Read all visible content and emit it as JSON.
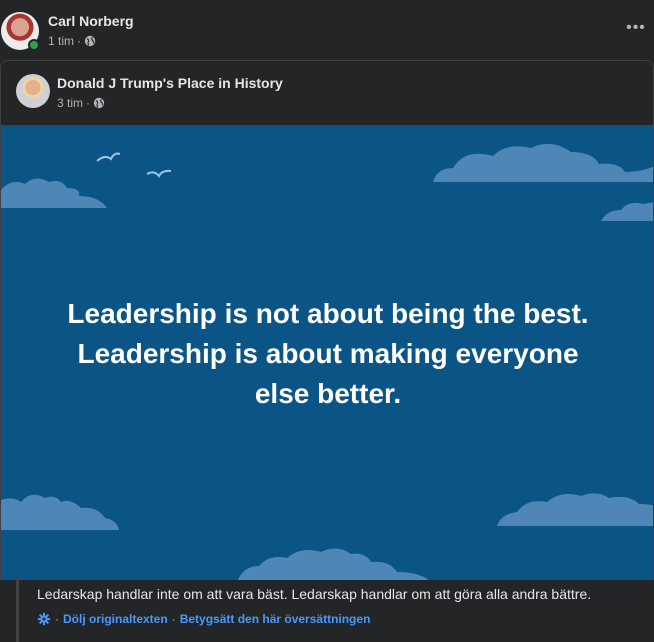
{
  "post": {
    "author": "Carl Norberg",
    "time": "1 tim",
    "separator": "·",
    "visibility_icon": "globe-icon",
    "more_icon": "more-horizontal-icon",
    "more_glyph": "•••"
  },
  "shared": {
    "author": "Donald J Trump's Place in History",
    "time": "3 tim",
    "separator": "·",
    "visibility_icon": "globe-icon",
    "quote_lines": [
      "Leadership is not about being the best.",
      "Leadership is about making everyone",
      "else better."
    ]
  },
  "translation": {
    "text": "Ledarskap handlar inte om att vara bäst. Ledarskap handlar om att göra alla andra bättre.",
    "hide_original": "Dölj originaltexten",
    "rate_translation": "Betygsätt den här översättningen",
    "separator": "·",
    "settings_icon": "gear-icon"
  },
  "colors": {
    "background": "#242526",
    "image_blue": "#0a5585",
    "cloud": "#4f86b8",
    "link_blue": "#4599ff",
    "online_green": "#31a24c"
  }
}
